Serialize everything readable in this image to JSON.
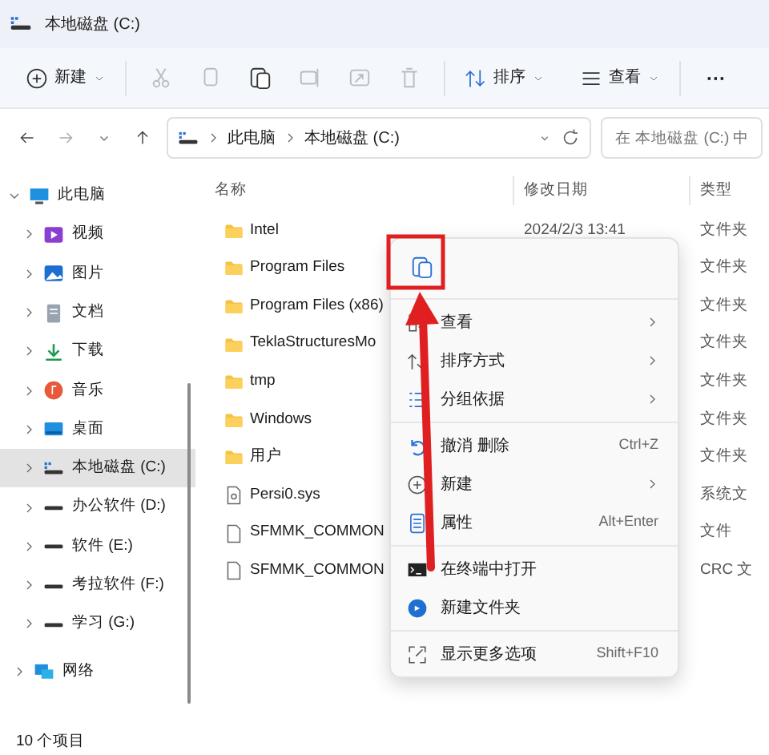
{
  "window": {
    "title": "本地磁盘 (C:)"
  },
  "toolbar": {
    "new_label": "新建",
    "tools": [
      {
        "disabled": true
      },
      {
        "disabled": true
      },
      {
        "disabled": false
      },
      {
        "disabled": true
      },
      {
        "disabled": true
      },
      {
        "disabled": true
      }
    ],
    "sort_label": "排序",
    "view_label": "查看",
    "more": "···"
  },
  "address": {
    "path": [
      "此电脑",
      "本地磁盘 (C:)"
    ],
    "search_placeholder": "在 本地磁盘 (C:) 中"
  },
  "sidebar": {
    "items": [
      {
        "label": "此电脑",
        "expanded": true,
        "selected": false,
        "children": [
          {
            "label": "视频",
            "expanded": false,
            "selected": false
          },
          {
            "label": "图片",
            "expanded": false,
            "selected": false
          },
          {
            "label": "文档",
            "expanded": false,
            "selected": false
          },
          {
            "label": "下载",
            "expanded": false,
            "selected": false
          },
          {
            "label": "音乐",
            "expanded": false,
            "selected": false
          },
          {
            "label": "桌面",
            "expanded": false,
            "selected": false
          },
          {
            "label": "本地磁盘 (C:)",
            "expanded": false,
            "selected": true
          },
          {
            "label": "办公软件 (D:)",
            "expanded": false,
            "selected": false
          },
          {
            "label": "软件 (E:)",
            "expanded": false,
            "selected": false
          },
          {
            "label": "考拉软件 (F:)",
            "expanded": false,
            "selected": false
          },
          {
            "label": "学习 (G:)",
            "expanded": false,
            "selected": false
          }
        ]
      },
      {
        "label": "网络",
        "expanded": false,
        "selected": false
      }
    ]
  },
  "table": {
    "columns": [
      "名称",
      "修改日期",
      "类型"
    ],
    "rows": [
      {
        "kind": "folder",
        "name": "Intel",
        "date": "2024/2/3 13:41",
        "type": "文件夹"
      },
      {
        "kind": "folder",
        "name": "Program Files",
        "type": "文件夹"
      },
      {
        "kind": "folder",
        "name": "Program Files (x86)",
        "type": "文件夹"
      },
      {
        "kind": "folder",
        "name": "TeklaStructuresMo",
        "type": "文件夹"
      },
      {
        "kind": "folder",
        "name": "tmp",
        "type": "文件夹"
      },
      {
        "kind": "folder",
        "name": "Windows",
        "type": "文件夹"
      },
      {
        "kind": "folder",
        "name": "用户",
        "type": "文件夹"
      },
      {
        "kind": "sysfile",
        "name": "Persi0.sys",
        "type": "系统文"
      },
      {
        "kind": "file",
        "name": "SFMMK_COMMON",
        "type": "文件"
      },
      {
        "kind": "file",
        "name": "SFMMK_COMMON",
        "type": "CRC 文"
      }
    ]
  },
  "context_menu": {
    "sections": [
      [
        {
          "label": "查看",
          "submenu": true
        },
        {
          "label": "排序方式",
          "submenu": true
        },
        {
          "label": "分组依据",
          "submenu": true
        }
      ],
      [
        {
          "label": "撤消 删除",
          "shortcut": "Ctrl+Z",
          "submenu": false
        },
        {
          "label": "新建",
          "submenu": true
        },
        {
          "label": "属性",
          "shortcut": "Alt+Enter",
          "submenu": false
        }
      ],
      [
        {
          "label": "在终端中打开",
          "submenu": false
        },
        {
          "label": "新建文件夹",
          "submenu": false
        }
      ],
      [
        {
          "label": "显示更多选项",
          "shortcut": "Shift+F10",
          "submenu": false
        }
      ]
    ]
  },
  "status_bar": "10 个项目"
}
